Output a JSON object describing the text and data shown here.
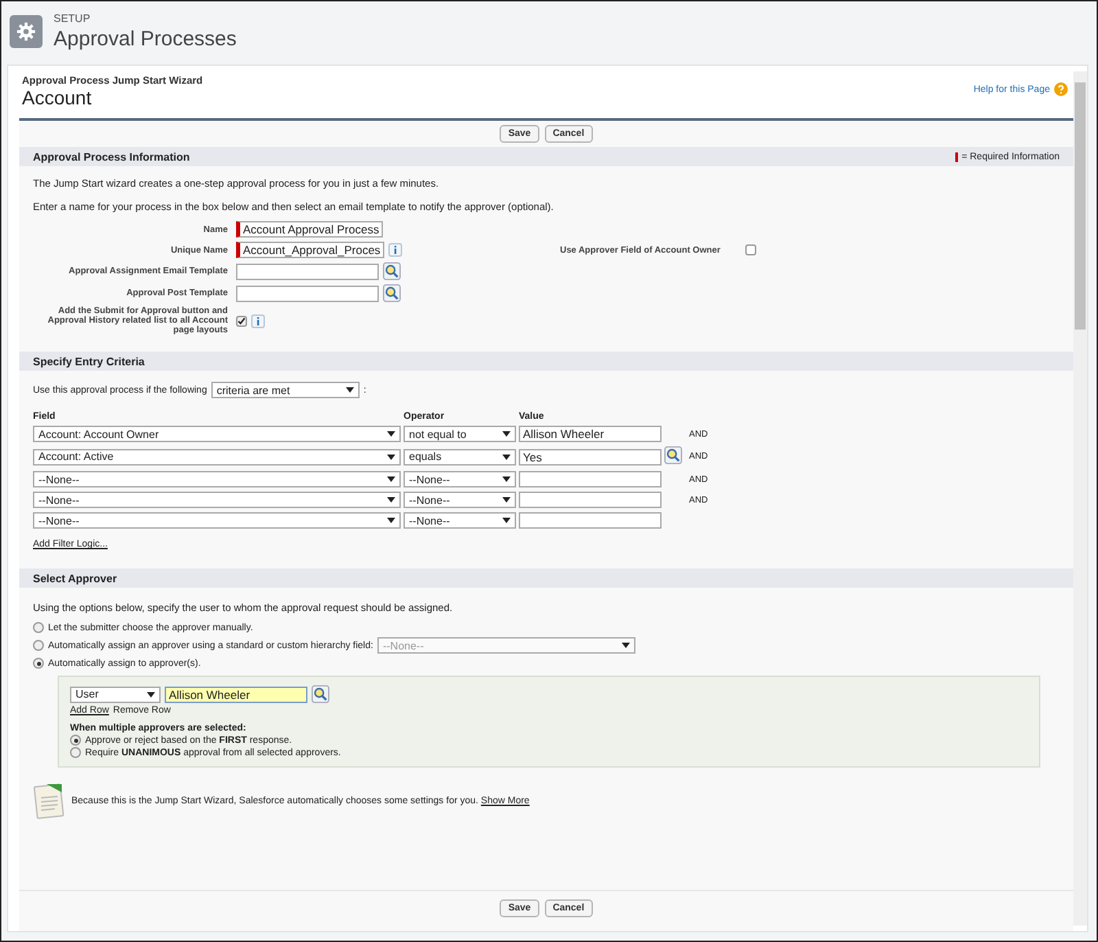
{
  "header": {
    "eyebrow": "SETUP",
    "title": "Approval Processes"
  },
  "page": {
    "breadcrumb": "Approval Process Jump Start Wizard",
    "title": "Account",
    "help_link": "Help for this Page"
  },
  "top_buttons": [
    "Save",
    "Cancel"
  ],
  "info_section": {
    "title": "Approval Process Information",
    "required_legend": "= Required Information",
    "intro": [
      "The Jump Start wizard creates a one-step approval process for you in just a few minutes.",
      "Enter a name for your process in the box below and then select an email template to notify the approver (optional)."
    ],
    "fields": [
      {
        "kind": "text",
        "label": "Name",
        "value": "Account Approval Process",
        "required": true,
        "info": false
      },
      {
        "kind": "text",
        "label": "Unique Name",
        "value": "Account_Approval_Proces",
        "required": true,
        "info": true
      },
      {
        "kind": "lookup",
        "label": "Approval Assignment Email Template",
        "required": false,
        "info": false
      },
      {
        "kind": "lookup",
        "label": "Approval Post Template",
        "required": false,
        "info": false
      },
      {
        "kind": "checkbox",
        "label": "Add the Submit for Approval button and Approval History related list to all Account page layouts",
        "checked": true,
        "info": true
      }
    ],
    "side_field": {
      "label": "Use Approver Field of Account Owner",
      "checked": false
    }
  },
  "entry_criteria": {
    "title": "Specify Entry Criteria",
    "prefix": "Use this approval process if the following",
    "mode": "criteria are met",
    "suffix": ":",
    "columns": [
      "Field",
      "Operator",
      "Value"
    ],
    "rows": [
      {
        "field": "Account: Account Owner",
        "operator": "not equal to",
        "value": "Allison Wheeler",
        "lookup": false,
        "conjunction": "AND"
      },
      {
        "field": "Account: Active",
        "operator": "equals",
        "value": "Yes",
        "lookup": true,
        "conjunction": "AND"
      },
      {
        "field": "--None--",
        "operator": "--None--",
        "lookup": false,
        "conjunction": "AND"
      },
      {
        "field": "--None--",
        "operator": "--None--",
        "lookup": false,
        "conjunction": "AND"
      },
      {
        "field": "--None--",
        "operator": "--None--",
        "lookup": false
      }
    ],
    "add_filter_logic": "Add Filter Logic..."
  },
  "approver": {
    "title": "Select Approver",
    "intro": "Using the options below, specify the user to whom the approval request should be assigned.",
    "options": [
      {
        "label": "Let the submitter choose the approver manually.",
        "selected": false
      },
      {
        "label": "Automatically assign an approver using a standard or custom hierarchy field:",
        "selected": false,
        "dropdown": "--None--"
      },
      {
        "label": "Automatically assign to approver(s).",
        "selected": true
      }
    ],
    "assignee": {
      "type": "User",
      "name": "Allison Wheeler"
    },
    "add_row": "Add Row",
    "remove_row": "Remove Row",
    "multi_title": "When multiple approvers are selected:",
    "multi_options": [
      {
        "label": "Approve or reject based on the **FIRST** response.",
        "selected": true
      },
      {
        "label": "Require **UNANIMOUS** approval from all selected approvers.",
        "selected": false
      }
    ]
  },
  "note": {
    "text": "Because this is the Jump Start Wizard, Salesforce automatically chooses some settings for you.",
    "link": "Show More"
  },
  "bottom_buttons": [
    "Save",
    "Cancel"
  ]
}
